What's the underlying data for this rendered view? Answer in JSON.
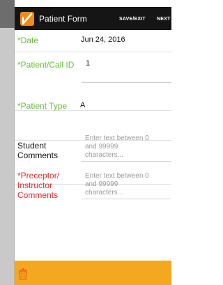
{
  "app": {
    "title": "Patient Form",
    "actions": {
      "save_exit": "SAVE/EXIT",
      "next": "NEXT"
    }
  },
  "form": {
    "fields": [
      {
        "label": "*Date",
        "value": "Jun 24, 2016"
      },
      {
        "label": "*Patient/Call ID",
        "value": "1"
      },
      {
        "label": "*Patient Type",
        "value": "A"
      },
      {
        "label_line1": "Student",
        "label_line2": "Comments",
        "placeholder_line1": "Enter text between 0",
        "placeholder_line2": "and 99999",
        "placeholder_line3": "characters..."
      },
      {
        "label_line1": "*Preceptor/",
        "label_line2": "Instructor",
        "label_line3": "Comments",
        "placeholder_line1": "Enter text between 0",
        "placeholder_line2": "and 99999",
        "placeholder_line3": "characters..."
      }
    ]
  },
  "colors": {
    "accent_orange": "#f3a820",
    "required_green": "#63c236",
    "required_red": "#ed2828",
    "app_bar": "#151515"
  },
  "icons": {
    "app_logo": "app-logo-icon",
    "delete": "trash-icon"
  }
}
